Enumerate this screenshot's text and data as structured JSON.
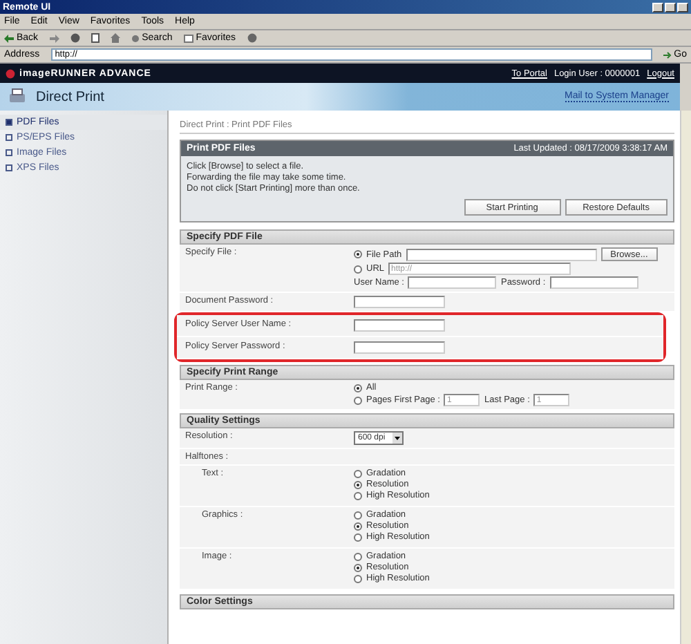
{
  "window": {
    "title": "Remote UI"
  },
  "menu": [
    "File",
    "Edit",
    "View",
    "Favorites",
    "Tools",
    "Help"
  ],
  "toolbar": {
    "back": "Back",
    "search": "Search",
    "favorites": "Favorites"
  },
  "address": {
    "label": "Address",
    "value": "http://",
    "go": "Go"
  },
  "header": {
    "brand": "imageRUNNER ADVANCE",
    "portal": "To Portal",
    "login_user": "Login User : 0000001",
    "logout": "Logout"
  },
  "banner": {
    "title": "Direct Print",
    "mail": "Mail to System Manager"
  },
  "sidebar": {
    "items": [
      {
        "label": "PDF Files",
        "selected": true
      },
      {
        "label": "PS/EPS Files",
        "selected": false
      },
      {
        "label": "Image Files",
        "selected": false
      },
      {
        "label": "XPS Files",
        "selected": false
      }
    ]
  },
  "breadcrumb": "Direct Print : Print PDF Files",
  "panel": {
    "title": "Print PDF Files",
    "last_updated": "Last Updated : 08/17/2009 3:38:17 AM",
    "messages": [
      "Click [Browse] to select a file.",
      "Forwarding the file may take some time.",
      "Do not click [Start Printing] more than once."
    ],
    "buttons": [
      "Start Printing",
      "Restore Defaults"
    ]
  },
  "specify_pdf_file": {
    "title": "Specify PDF File",
    "label": "Specify File :",
    "file_path": {
      "label": "File Path",
      "selected": true
    },
    "browse": "Browse...",
    "url": {
      "label": "URL",
      "selected": false,
      "placeholder": "http://"
    },
    "user_name_label": "User Name :",
    "password_label": "Password :",
    "document_password_label": "Document Password :",
    "policy": {
      "highlighted": true,
      "user_name_label": "Policy Server User Name :",
      "password_label": "Policy Server Password :"
    }
  },
  "print_range": {
    "title": "Specify Print Range",
    "label": "Print Range :",
    "all": {
      "label": "All",
      "selected": true
    },
    "pages": {
      "label": "Pages First Page :",
      "selected": false
    },
    "first_page": "1",
    "last_page_label": "Last Page :",
    "last_page": "1"
  },
  "quality": {
    "title": "Quality Settings",
    "resolution_label": "Resolution :",
    "resolution": "600 dpi",
    "halftones_label": "Halftones :",
    "groups": [
      {
        "label": "Text :",
        "options": [
          {
            "label": "Gradation",
            "selected": false
          },
          {
            "label": "Resolution",
            "selected": true
          },
          {
            "label": "High Resolution",
            "selected": false
          }
        ]
      },
      {
        "label": "Graphics :",
        "options": [
          {
            "label": "Gradation",
            "selected": false
          },
          {
            "label": "Resolution",
            "selected": true
          },
          {
            "label": "High Resolution",
            "selected": false
          }
        ]
      },
      {
        "label": "Image :",
        "options": [
          {
            "label": "Gradation",
            "selected": false
          },
          {
            "label": "Resolution",
            "selected": true
          },
          {
            "label": "High Resolution",
            "selected": false
          }
        ]
      }
    ]
  },
  "color_settings": {
    "title": "Color Settings"
  }
}
